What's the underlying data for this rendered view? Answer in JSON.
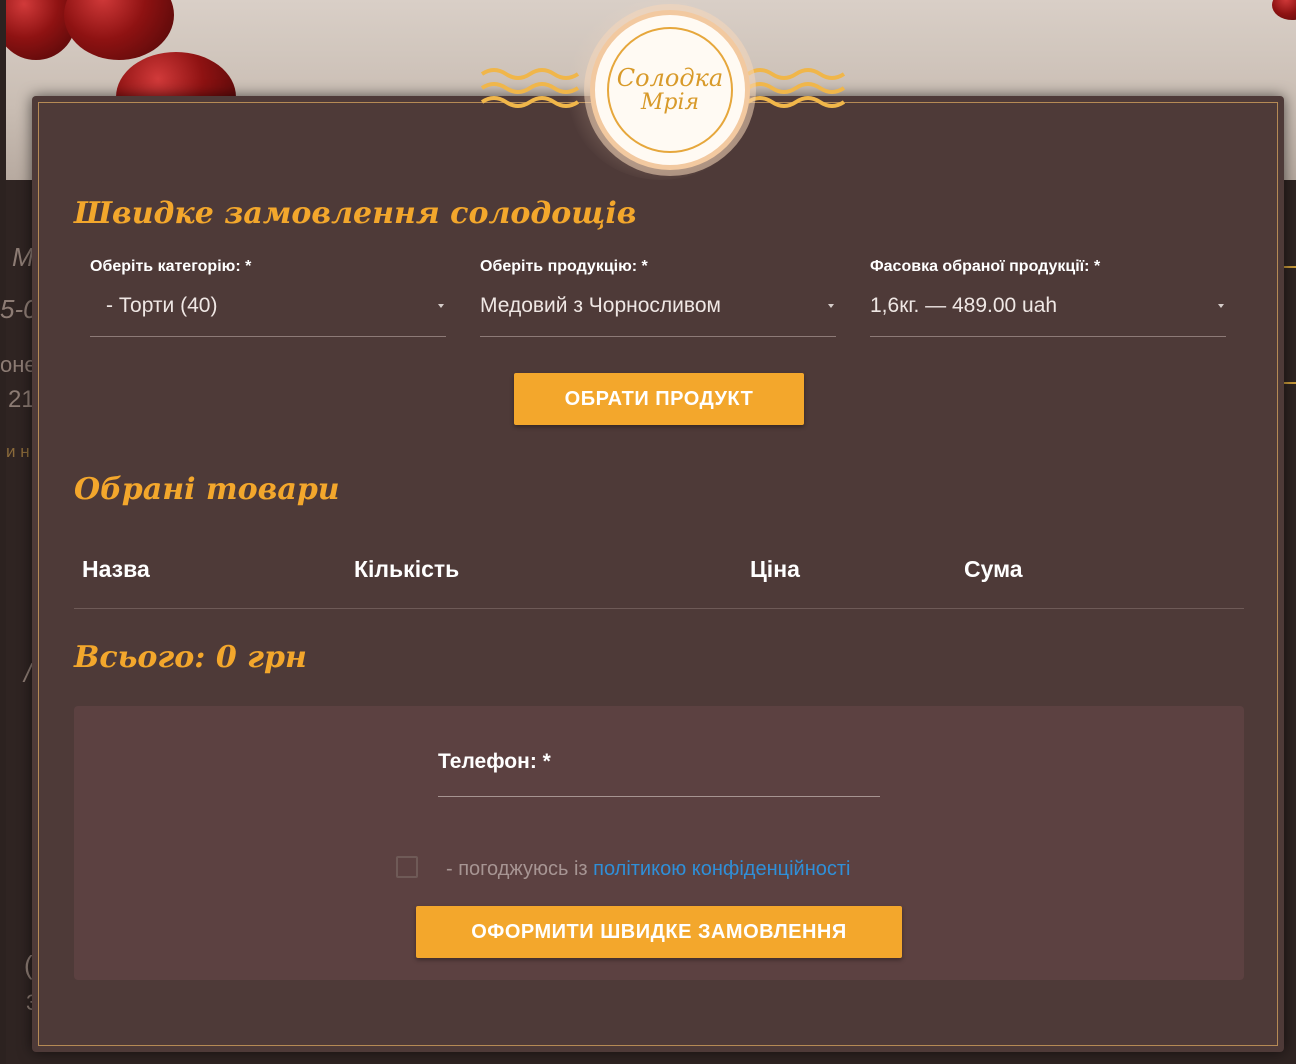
{
  "brand": {
    "logo_line1": "Солодка",
    "logo_line2": "Мрія"
  },
  "background": {
    "text1": "М",
    "text2": "5-0",
    "text3": "оне",
    "text4": "21",
    "text5": "и н",
    "text6": "/",
    "text7": "(",
    "text8": "3"
  },
  "modal": {
    "title": "Швидке замовлення солодощів",
    "fields": [
      {
        "label": "Оберіть категорію: *",
        "value": "- Торти (40)"
      },
      {
        "label": "Оберіть продукцію: *",
        "value": "Медовий з Чорносливом"
      },
      {
        "label": "Фасовка обраної продукції: *",
        "value": "1,6кг. — 489.00 uah"
      }
    ],
    "choose_button": "ОБРАТИ ПРОДУКТ",
    "selected_title": "Обрані товари",
    "table_headers": [
      "Назва",
      "Кількість",
      "Ціна",
      "Сума"
    ],
    "total": "Всього: 0 грн",
    "phone_label": "Телефон: *",
    "agree_prefix": "- погоджуюсь із ",
    "agree_link": "політикою конфіденційності",
    "submit_button": "ОФОРМИТИ ШВИДКЕ ЗАМОВЛЕННЯ"
  },
  "colors": {
    "accent": "#f3a72c",
    "modal_bg": "#4e3a38",
    "form_bg": "#5c4141",
    "link": "#2f8fd8"
  }
}
